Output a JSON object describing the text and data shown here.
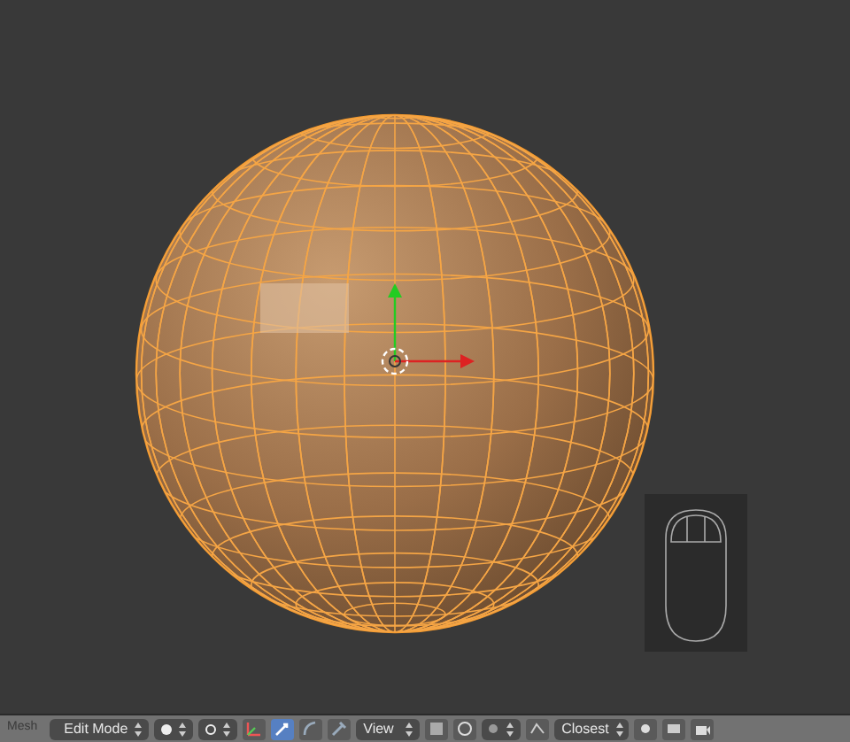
{
  "toolbar": {
    "menu_label": "Mesh",
    "mode": "Edit Mode",
    "manipulator_modes": [
      {
        "kind": "translate",
        "selected": true
      },
      {
        "kind": "rotate",
        "selected": false
      },
      {
        "kind": "scale",
        "selected": false
      }
    ],
    "orientation": "View",
    "snap_target": "Closest"
  }
}
